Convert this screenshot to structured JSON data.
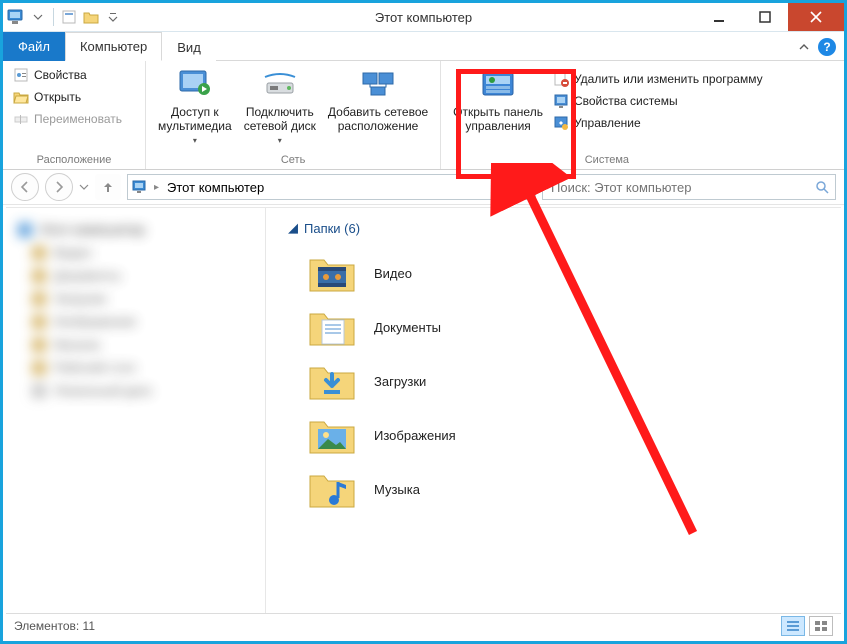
{
  "window": {
    "title": "Этот компьютер"
  },
  "tabs": {
    "file": "Файл",
    "computer": "Компьютер",
    "view": "Вид"
  },
  "ribbon": {
    "groups": {
      "location": {
        "label": "Расположение",
        "properties": "Свойства",
        "open": "Открыть",
        "rename": "Переименовать"
      },
      "network": {
        "label": "Сеть",
        "media": "Доступ к\nмультимедиа",
        "map_drive": "Подключить\nсетевой диск",
        "add_location": "Добавить сетевое\nрасположение"
      },
      "system": {
        "label": "Система",
        "control_panel": "Открыть панель\nуправления",
        "uninstall": "Удалить или изменить программу",
        "sys_props": "Свойства системы",
        "manage": "Управление"
      }
    }
  },
  "nav": {
    "address": "Этот компьютер",
    "search_placeholder": "Поиск: Этот компьютер"
  },
  "content": {
    "section": "Папки (6)",
    "folders": [
      {
        "name": "Видео"
      },
      {
        "name": "Документы"
      },
      {
        "name": "Загрузки"
      },
      {
        "name": "Изображения"
      },
      {
        "name": "Музыка"
      }
    ]
  },
  "status": {
    "items": "Элементов: 11"
  }
}
